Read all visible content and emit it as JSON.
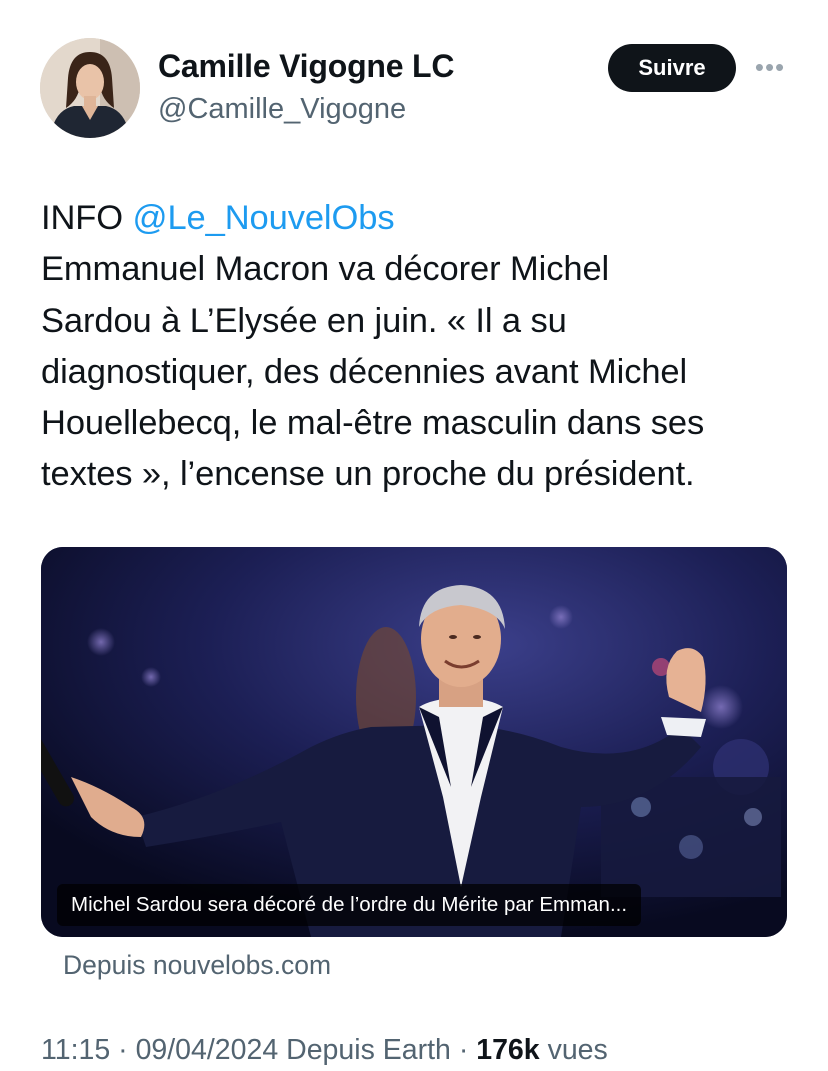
{
  "author": {
    "display_name": "Camille Vigogne LC",
    "handle": "@Camille_Vigogne"
  },
  "actions": {
    "follow_label": "Suivre",
    "more_icon": "more-horizontal-icon"
  },
  "tweet": {
    "prefix": "INFO",
    "mention": "@Le_NouvelObs",
    "lines": [
      "Emmanuel Macron va décorer Michel",
      "Sardou à L’Elysée en juin. « Il a su",
      "diagnostiquer, des décennies avant Michel",
      "Houellebecq, le mal-être masculin dans ses",
      "textes », l’encense un proche du président."
    ]
  },
  "card": {
    "caption": "Michel Sardou sera décoré de l’ordre du Mérite par Emman...",
    "source": "Depuis nouvelobs.com"
  },
  "meta": {
    "time": "11:15",
    "separator": "·",
    "date": "09/04/2024",
    "via": "Depuis Earth",
    "views_count": "176k",
    "views_label": "vues"
  },
  "colors": {
    "text": "#0f1419",
    "secondary": "#536471",
    "link": "#1d9bf0",
    "button_bg": "#0f1419"
  }
}
